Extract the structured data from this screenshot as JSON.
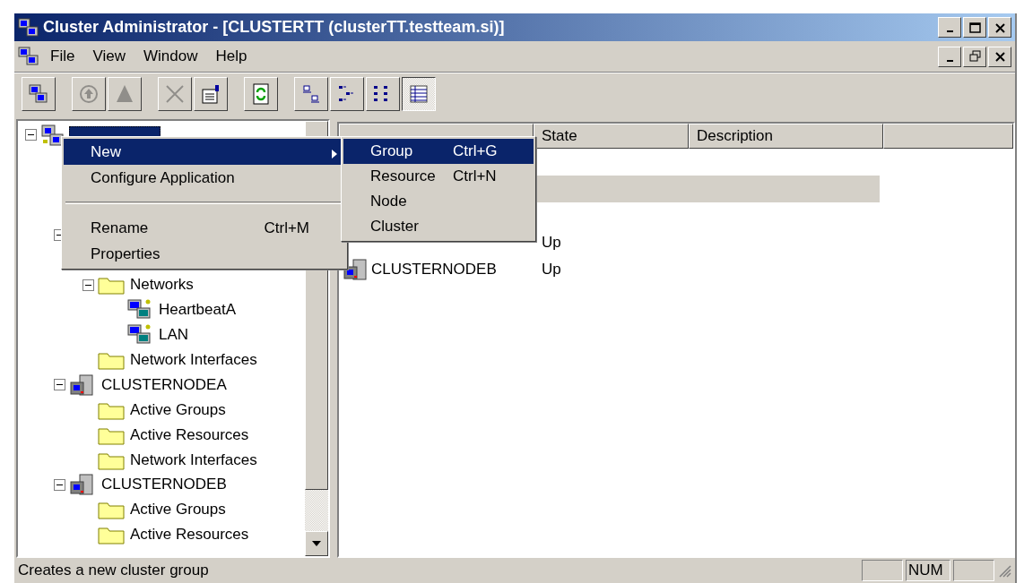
{
  "window": {
    "title": "Cluster Administrator - [CLUSTERTT (clusterTT.testteam.si)]"
  },
  "menu_bar": [
    "File",
    "View",
    "Window",
    "Help"
  ],
  "toolbar": [
    {
      "kind": "button",
      "disabled": false,
      "pressed": false
    },
    {
      "kind": "separator"
    },
    {
      "kind": "button",
      "disabled": true,
      "pressed": false
    },
    {
      "kind": "button",
      "disabled": true,
      "pressed": false
    },
    {
      "kind": "separator"
    },
    {
      "kind": "button",
      "disabled": true,
      "pressed": false
    },
    {
      "kind": "button",
      "disabled": false,
      "pressed": false
    },
    {
      "kind": "separator"
    },
    {
      "kind": "button",
      "disabled": false,
      "pressed": false
    },
    {
      "kind": "separator"
    },
    {
      "kind": "button",
      "disabled": false,
      "pressed": false
    },
    {
      "kind": "button",
      "disabled": false,
      "pressed": false
    },
    {
      "kind": "button",
      "disabled": false,
      "pressed": false
    },
    {
      "kind": "button",
      "disabled": false,
      "pressed": true
    }
  ],
  "tree": [
    {
      "kind": "cluster",
      "expanded": true,
      "selected": true,
      "children": [
        {
          "kind": "folder"
        },
        {
          "kind": "folder"
        },
        {
          "kind": "folder"
        },
        {
          "kind": "folder",
          "expanded": true,
          "children": [
            {
              "kind": "folder"
            },
            {
              "kind": "folder",
              "label": "Networks",
              "expanded": true,
              "selected": false,
              "children": [
                {
                  "kind": "network",
                  "label": "HeartbeatA",
                  "selected": false
                },
                {
                  "kind": "network",
                  "label": "LAN",
                  "selected": false
                }
              ]
            },
            {
              "kind": "folder",
              "label": "Network Interfaces",
              "selected": false
            }
          ]
        },
        {
          "kind": "node",
          "label": "CLUSTERNODEA",
          "expanded": true,
          "selected": false,
          "children": [
            {
              "kind": "folder",
              "label": "Active Groups",
              "selected": false
            },
            {
              "kind": "folder",
              "label": "Active Resources",
              "selected": false
            },
            {
              "kind": "folder",
              "label": "Network Interfaces",
              "selected": false
            }
          ]
        },
        {
          "kind": "node",
          "label": "CLUSTERNODEB",
          "expanded": true,
          "selected": false,
          "children": [
            {
              "kind": "folder",
              "label": "Active Groups",
              "selected": false
            },
            {
              "kind": "folder",
              "label": "Active Resources",
              "selected": false
            }
          ]
        }
      ]
    }
  ],
  "list": {
    "columns": [
      "State",
      "Description"
    ],
    "rows": [
      {
        "selected": false
      },
      {
        "selected": true
      },
      {
        "selected": false
      },
      {
        "state": "Up",
        "selected": false
      },
      {
        "name": "CLUSTERNODEB",
        "state": "Up",
        "selected": false
      }
    ]
  },
  "context_menu": {
    "items": [
      {
        "kind": "item",
        "label": "New",
        "submenu": true,
        "selected": true
      },
      {
        "kind": "item",
        "label": "Configure Application",
        "selected": false
      },
      {
        "kind": "separator"
      },
      {
        "kind": "item",
        "label": "Rename",
        "shortcut": "Ctrl+M",
        "selected": false
      },
      {
        "kind": "item",
        "label": "Properties",
        "selected": false
      }
    ]
  },
  "submenu": {
    "items": [
      {
        "label": "Group",
        "shortcut": "Ctrl+G",
        "selected": true
      },
      {
        "label": "Resource",
        "shortcut": "Ctrl+N",
        "selected": false
      },
      {
        "label": "Node",
        "selected": false
      },
      {
        "label": "Cluster",
        "selected": false
      }
    ]
  },
  "status_bar": {
    "text": "Creates a new cluster group",
    "panes": [
      {
        "kind": "blank"
      },
      {
        "kind": "text",
        "text": "NUM"
      },
      {
        "kind": "blank"
      }
    ]
  }
}
